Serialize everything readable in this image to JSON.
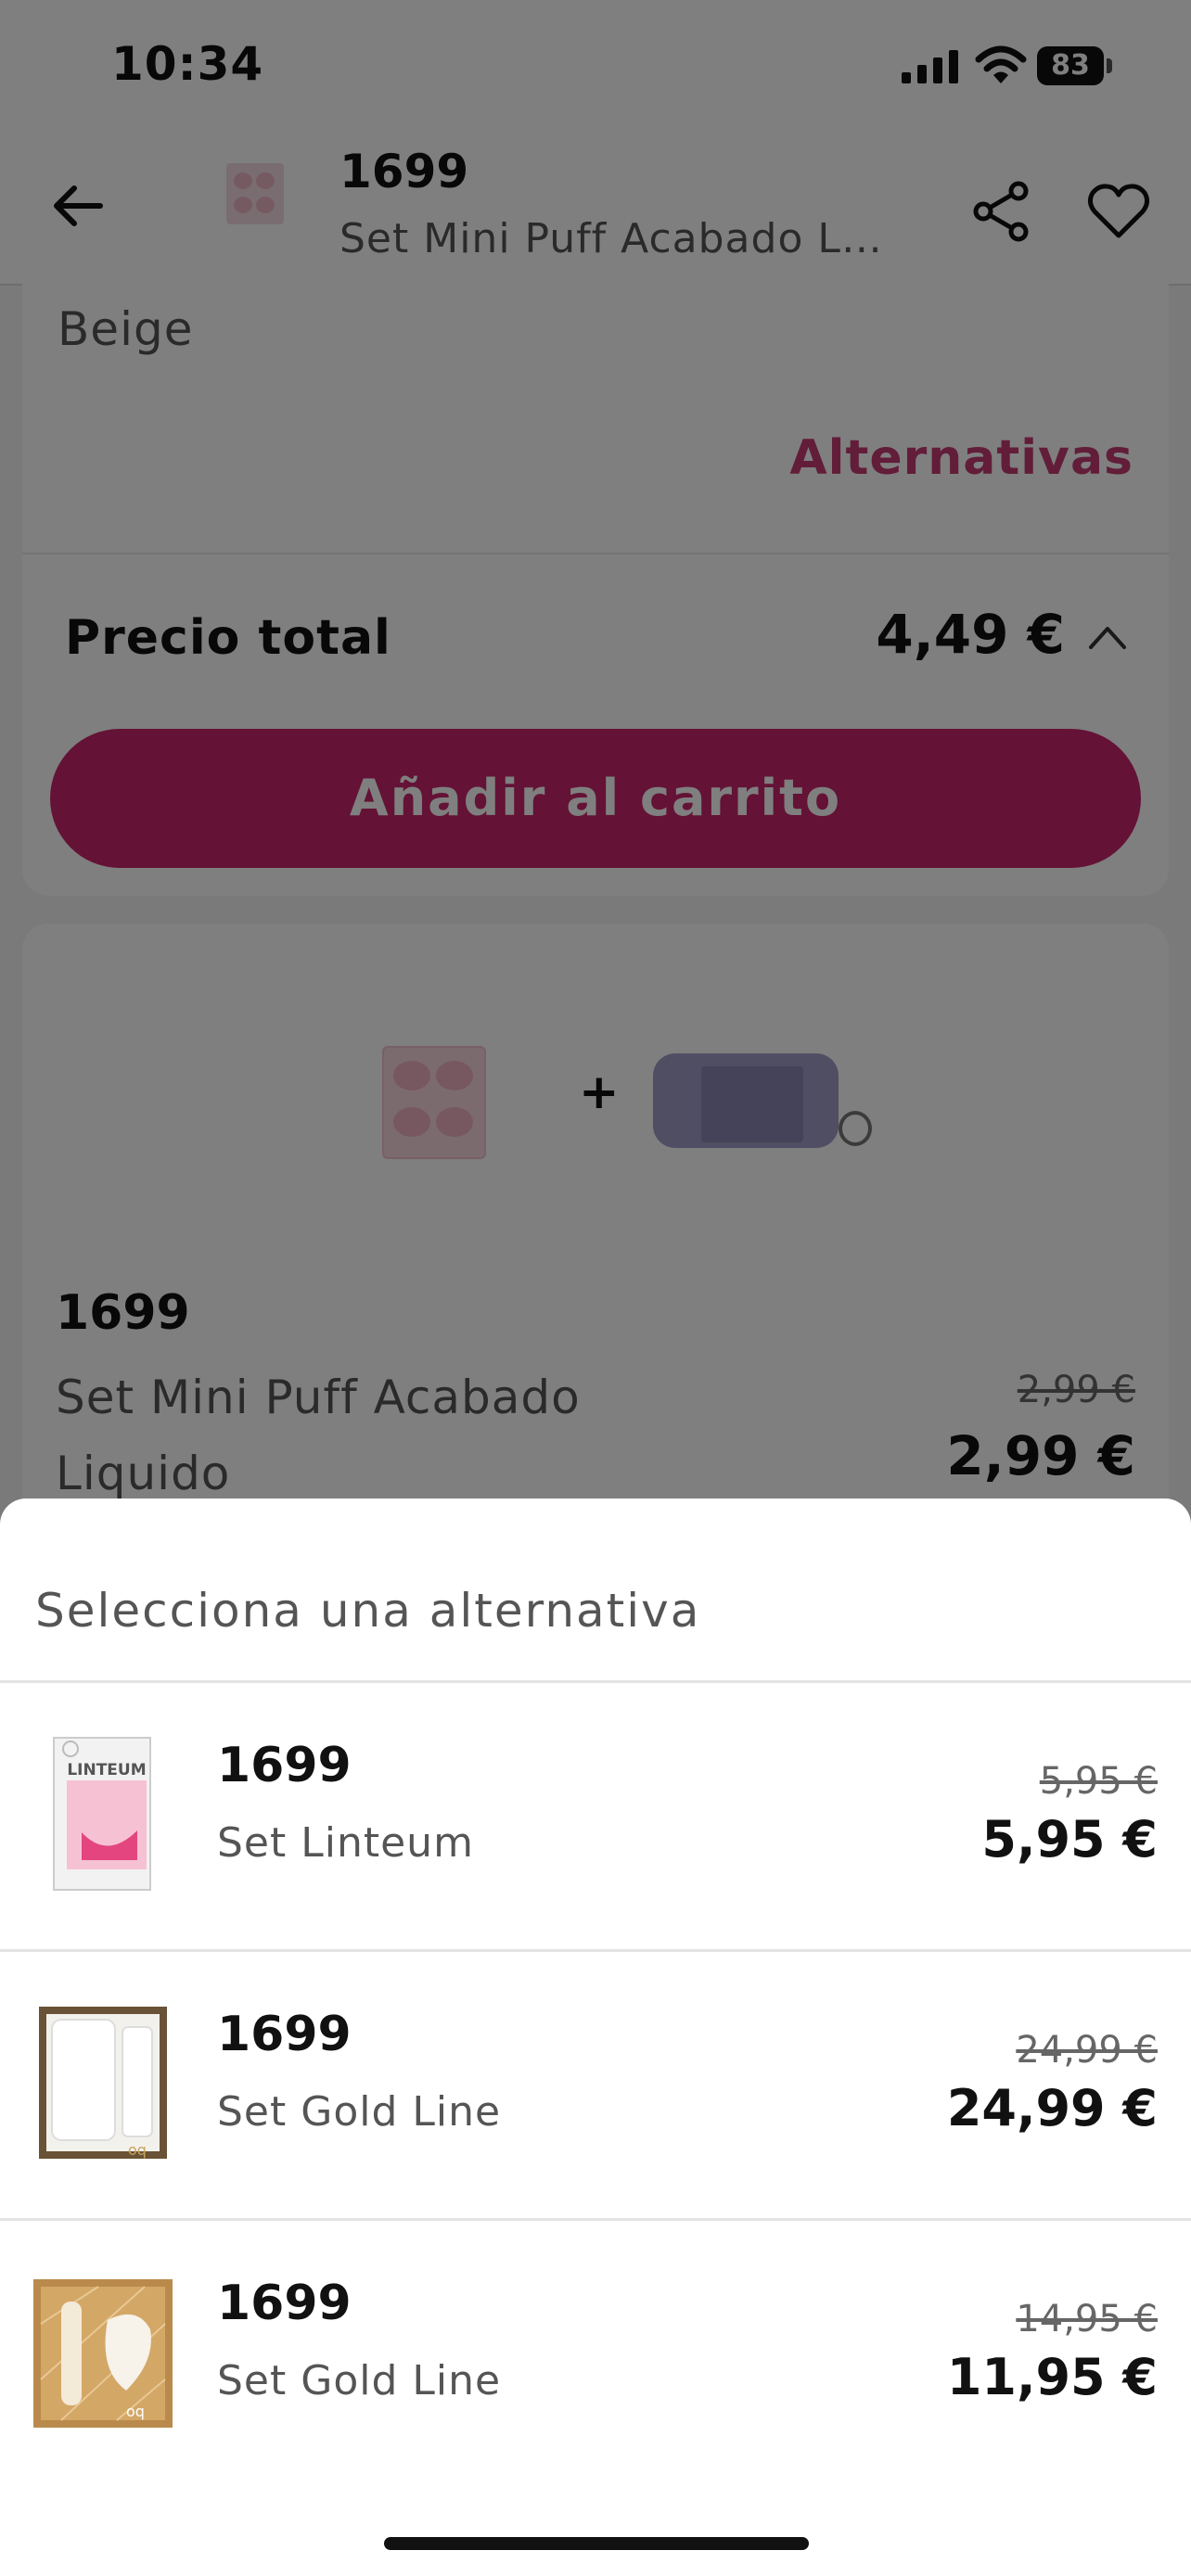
{
  "status_bar": {
    "time": "10:34",
    "battery": "83",
    "icons": [
      "signal-icon",
      "wifi-icon",
      "battery-icon"
    ]
  },
  "header": {
    "back_icon": "arrow-left-icon",
    "product_code": "1699",
    "product_name": "Set Mini Puff Acabado Liquido",
    "share_icon": "share-icon",
    "favorite_icon": "heart-icon"
  },
  "product_card": {
    "variant": "Beige",
    "alternatives_label": "Alternativas",
    "total_label": "Precio total",
    "total_price": "4,49 €",
    "add_to_cart_label": "Añadir al carrito"
  },
  "bundle_card": {
    "plus": "+",
    "code": "1699",
    "name": "Set Mini Puff Acabado Liquido",
    "old_price": "2,99 €",
    "price": "2,99 €"
  },
  "sheet": {
    "title": "Selecciona una alternativa",
    "alternatives": [
      {
        "code": "1699",
        "name": "Set Linteum",
        "old_price": "5,95 €",
        "price": "5,95 €",
        "thumb_text": "LINTEUM"
      },
      {
        "code": "1699",
        "name": "Set Gold Line",
        "old_price": "24,99 €",
        "price": "24,99 €",
        "thumb_text": "oq"
      },
      {
        "code": "1699",
        "name": "Set Gold Line",
        "old_price": "14,95 €",
        "price": "11,95 €",
        "thumb_text": "oq"
      }
    ]
  },
  "colors": {
    "accent": "#c43a72",
    "button": "#c8246d",
    "overlay": "rgba(0,0,0,0.5)"
  }
}
